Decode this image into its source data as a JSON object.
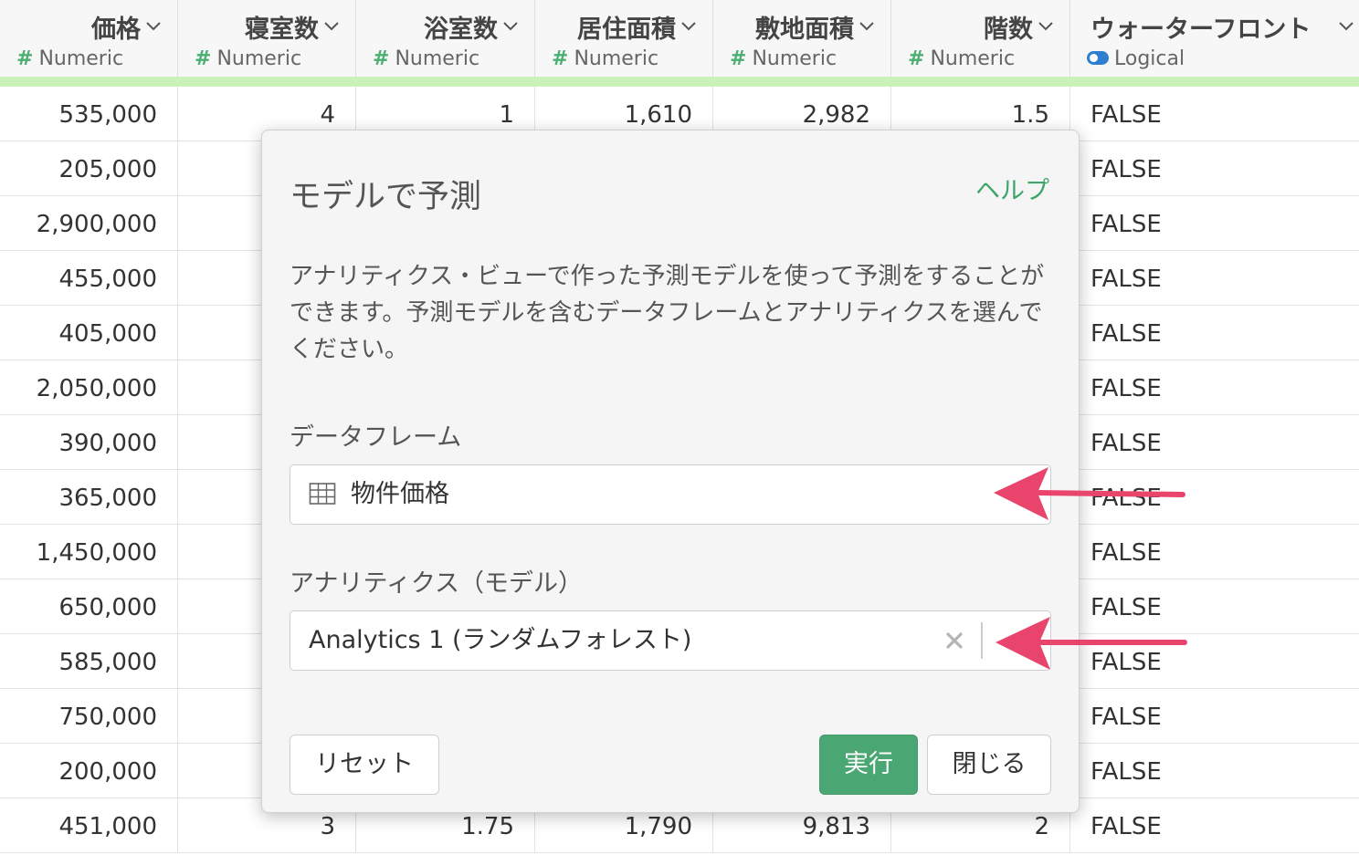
{
  "columns": [
    {
      "name": "価格",
      "type": "Numeric",
      "type_icon": "hash-icon"
    },
    {
      "name": "寝室数",
      "type": "Numeric",
      "type_icon": "hash-icon"
    },
    {
      "name": "浴室数",
      "type": "Numeric",
      "type_icon": "hash-icon"
    },
    {
      "name": "居住面積",
      "type": "Numeric",
      "type_icon": "hash-icon"
    },
    {
      "name": "敷地面積",
      "type": "Numeric",
      "type_icon": "hash-icon"
    },
    {
      "name": "階数",
      "type": "Numeric",
      "type_icon": "hash-icon"
    },
    {
      "name": "ウォーターフロント",
      "type": "Logical",
      "type_icon": "toggle-icon"
    }
  ],
  "rows": [
    {
      "price": "535,000",
      "bedrooms": "4",
      "bathrooms": "1",
      "living": "1,610",
      "lot": "2,982",
      "floors": "1.5",
      "waterfront": "FALSE"
    },
    {
      "price": "205,000",
      "waterfront": "FALSE"
    },
    {
      "price": "2,900,000",
      "waterfront": "FALSE"
    },
    {
      "price": "455,000",
      "waterfront": "FALSE"
    },
    {
      "price": "405,000",
      "waterfront": "FALSE"
    },
    {
      "price": "2,050,000",
      "waterfront": "FALSE"
    },
    {
      "price": "390,000",
      "waterfront": "FALSE"
    },
    {
      "price": "365,000",
      "waterfront": "FALSE"
    },
    {
      "price": "1,450,000",
      "waterfront": "FALSE"
    },
    {
      "price": "650,000",
      "waterfront": "FALSE"
    },
    {
      "price": "585,000",
      "waterfront": "FALSE"
    },
    {
      "price": "750,000",
      "waterfront": "FALSE"
    },
    {
      "price": "200,000",
      "waterfront": "FALSE"
    },
    {
      "price": "451,000",
      "bedrooms": "3",
      "bathrooms": "1.75",
      "living": "1,790",
      "lot": "9,813",
      "floors": "2",
      "waterfront": "FALSE"
    }
  ],
  "modal": {
    "title": "モデルで予測",
    "help_link": "ヘルプ",
    "description": "アナリティクス・ビューで作った予測モデルを使って予測をすることができます。予測モデルを含むデータフレームとアナリティクスを選んでください。",
    "dataframe_label": "データフレーム",
    "dataframe_value": "物件価格",
    "analytics_label": "アナリティクス（モデル）",
    "analytics_value": "Analytics 1 (ランダムフォレスト)",
    "reset_button": "リセット",
    "run_button": "実行",
    "close_button": "閉じる"
  },
  "colors": {
    "primary": "#4aa672",
    "help_link": "#3fa56a",
    "header_accent_bar": "#c8f2b8",
    "annotation_arrow": "#e8446c",
    "numeric_icon": "#4caf72",
    "logical_icon": "#2f7fd1"
  }
}
